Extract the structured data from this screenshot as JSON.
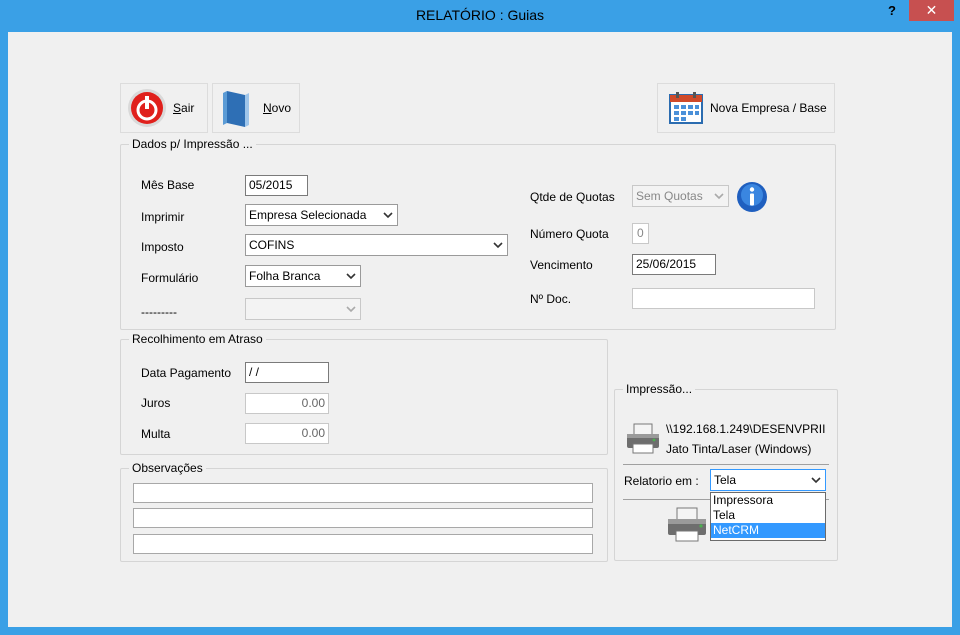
{
  "window": {
    "title": "RELATÓRIO : Guias",
    "help": "?",
    "close": "✕"
  },
  "toolbar": {
    "sair_label_first": "S",
    "sair_label_rest": "air",
    "novo_label_first": "N",
    "novo_label_rest": "ovo",
    "nova_empresa_label": "Nova Empresa / Base"
  },
  "dados": {
    "title": "Dados p/ Impressão ...",
    "mes_base_label": "Mês Base",
    "mes_base_value": "05/2015",
    "imprimir_label": "Imprimir",
    "imprimir_value": "Empresa Selecionada",
    "imposto_label": "Imposto",
    "imposto_value": "COFINS",
    "formulario_label": "Formulário",
    "formulario_value": "Folha Branca",
    "dashes_label": "---------",
    "dashes_value": "",
    "qtde_quotas_label": "Qtde de Quotas",
    "qtde_quotas_value": "Sem Quotas",
    "numero_quota_label": "Número  Quota",
    "numero_quota_value": "0",
    "vencimento_label": "Vencimento",
    "vencimento_value": "25/06/2015",
    "ndoc_label": "Nº  Doc.",
    "ndoc_value": ""
  },
  "recolhimento": {
    "title": "Recolhimento em Atraso",
    "data_pagamento_label": "Data Pagamento",
    "data_pagamento_value": " / /",
    "juros_label": "Juros",
    "juros_value": "0.00",
    "multa_label": "Multa",
    "multa_value": "0.00"
  },
  "observacoes": {
    "title": "Observações",
    "lines": [
      "",
      "",
      ""
    ]
  },
  "impressao": {
    "title": "Impressão...",
    "printer_path": "\\\\192.168.1.249\\DESENVPRII",
    "printer_driver": "Jato Tinta/Laser (Windows)",
    "relatorio_em_label": "Relatorio em :",
    "relatorio_em_value": "Tela",
    "options": [
      "Impressora",
      "Tela",
      "NetCRM"
    ],
    "highlighted_option": "NetCRM"
  },
  "colors": {
    "frame": "#3aa0e6",
    "close": "#c75050",
    "highlight": "#3399ff",
    "info_blue": "#1f5fbf"
  },
  "icons": [
    "power-icon",
    "book-icon",
    "calendar-icon",
    "info-icon",
    "printer-icon",
    "chevron-down-icon"
  ]
}
